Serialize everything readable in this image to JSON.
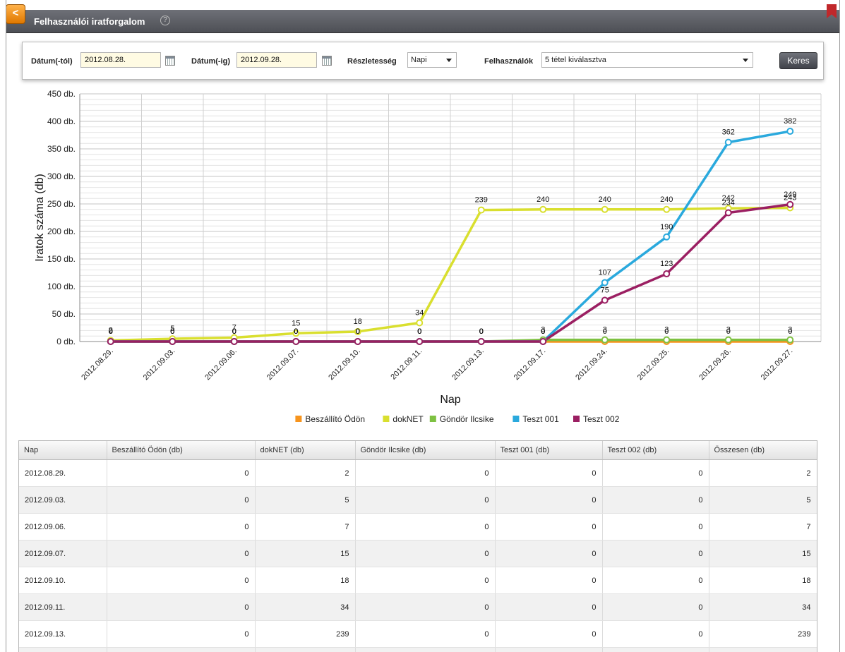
{
  "window": {
    "title": "Felhasználói iratforgalom",
    "back_icon": "<",
    "help_icon": "?"
  },
  "filters": {
    "date_from_label": "Dátum(-tól)",
    "date_from_value": "2012.08.28.",
    "date_to_label": "Dátum(-ig)",
    "date_to_value": "2012.09.28.",
    "detail_label": "Részletesség",
    "detail_value": "Napi",
    "users_label": "Felhasználók",
    "users_value": "5 tétel kiválasztva",
    "search_label": "Keres"
  },
  "chart_data": {
    "type": "line",
    "ylabel": "Iratok száma (db)",
    "xlabel": "Nap",
    "ylim": [
      0,
      450
    ],
    "ytick_step": 50,
    "ytick_suffix": " db.",
    "grid": true,
    "legend_position": "bottom",
    "categories": [
      "2012.08.29.",
      "2012.09.03.",
      "2012.09.06.",
      "2012.09.07.",
      "2012.09.10.",
      "2012.09.11.",
      "2012.09.13.",
      "2012.09.17.",
      "2012.09.24.",
      "2012.09.25.",
      "2012.09.26.",
      "2012.09.27."
    ],
    "series": [
      {
        "name": "Beszállító Ödön",
        "color": "#f7941d",
        "values": [
          0,
          0,
          0,
          0,
          0,
          0,
          0,
          0,
          0,
          0,
          0,
          0
        ]
      },
      {
        "name": "dokNET",
        "color": "#d9df2f",
        "values": [
          2,
          5,
          7,
          15,
          18,
          34,
          239,
          240,
          240,
          240,
          242,
          243
        ]
      },
      {
        "name": "Göndör Ilcsike",
        "color": "#7ec142",
        "values": [
          0,
          0,
          0,
          0,
          0,
          0,
          0,
          3,
          3,
          3,
          3,
          3
        ]
      },
      {
        "name": "Teszt 001",
        "color": "#2aa9dd",
        "values": [
          0,
          0,
          0,
          0,
          0,
          0,
          0,
          0,
          107,
          190,
          362,
          382
        ]
      },
      {
        "name": "Teszt 002",
        "color": "#9b1f62",
        "values": [
          0,
          0,
          0,
          0,
          0,
          0,
          0,
          0,
          75,
          123,
          234,
          249
        ]
      }
    ]
  },
  "table": {
    "headers": [
      "Nap",
      "Beszállító Ödön (db)",
      "dokNET (db)",
      "Göndör Ilcsike (db)",
      "Teszt 001 (db)",
      "Teszt 002 (db)",
      "Összesen (db)"
    ],
    "rows": [
      [
        "2012.08.29.",
        "0",
        "2",
        "0",
        "0",
        "0",
        "2"
      ],
      [
        "2012.09.03.",
        "0",
        "5",
        "0",
        "0",
        "0",
        "5"
      ],
      [
        "2012.09.06.",
        "0",
        "7",
        "0",
        "0",
        "0",
        "7"
      ],
      [
        "2012.09.07.",
        "0",
        "15",
        "0",
        "0",
        "0",
        "15"
      ],
      [
        "2012.09.10.",
        "0",
        "18",
        "0",
        "0",
        "0",
        "18"
      ],
      [
        "2012.09.11.",
        "0",
        "34",
        "0",
        "0",
        "0",
        "34"
      ],
      [
        "2012.09.13.",
        "0",
        "239",
        "0",
        "0",
        "0",
        "239"
      ],
      [
        "",
        "",
        "",
        "",
        "",
        "",
        ""
      ]
    ]
  }
}
